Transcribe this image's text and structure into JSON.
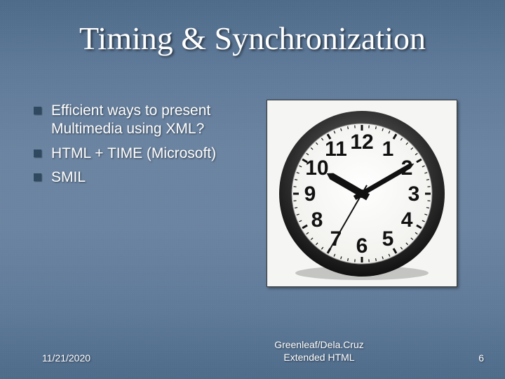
{
  "title": "Timing & Synchronization",
  "bullets": [
    "Efficient ways to present Multimedia using XML?",
    "HTML + TIME (Microsoft)",
    "SMIL"
  ],
  "clock": {
    "numbers": [
      "12",
      "1",
      "2",
      "3",
      "4",
      "5",
      "6",
      "7",
      "8",
      "9",
      "10",
      "11"
    ],
    "hour_hand_angle": 300,
    "minute_hand_angle": 60,
    "second_hand_angle": 210
  },
  "footer": {
    "left": "11/21/2020",
    "center_line1": "Greenleaf/Dela.Cruz",
    "center_line2": "Extended HTML",
    "right": "6"
  }
}
